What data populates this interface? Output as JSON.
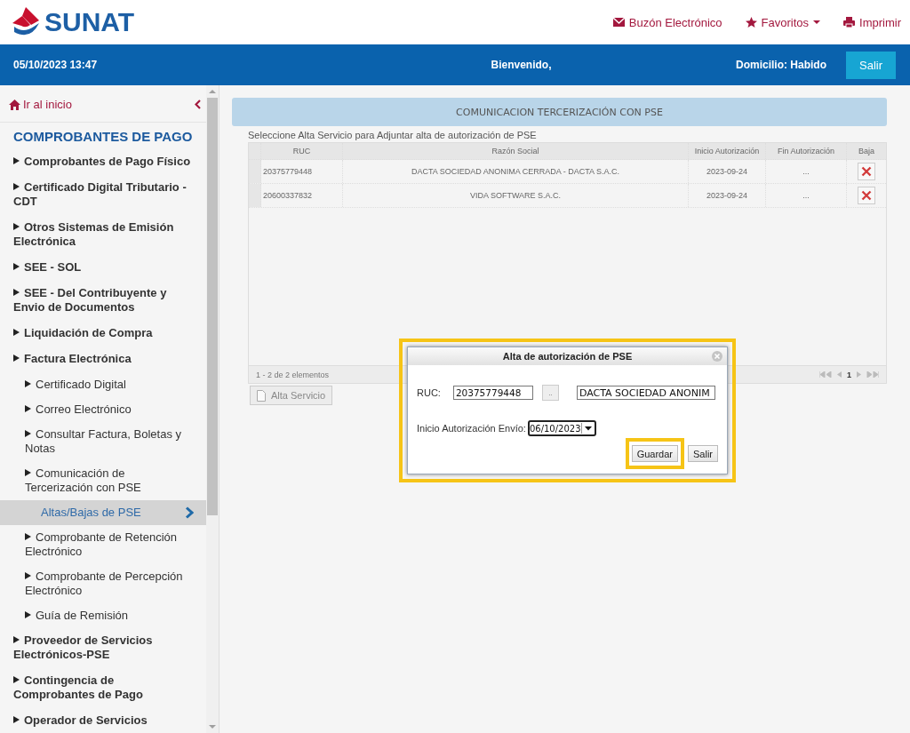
{
  "header": {
    "logo": "SUNAT",
    "links": [
      {
        "kind": "mail",
        "label": "Buzón Electrónico",
        "dropdown": false
      },
      {
        "kind": "star",
        "label": "Favoritos",
        "dropdown": true
      },
      {
        "kind": "print",
        "label": "Imprimir",
        "dropdown": false
      }
    ]
  },
  "top_bar": {
    "datetime": "05/10/2023 13:47",
    "welcome": "Bienvenido,",
    "domicilio": "Domicilio: Habido",
    "logout": "Salir"
  },
  "sidebar": {
    "home_link": "Ir al inicio",
    "section_title": "COMPROBANTES DE PAGO",
    "items": [
      {
        "kind": "folder",
        "label": "Comprobantes de Pago Físico",
        "selected": false
      },
      {
        "kind": "folder",
        "label": "Certificado Digital Tributario - CDT",
        "selected": false
      },
      {
        "kind": "folder",
        "label": "Otros Sistemas de Emisión Electrónica",
        "selected": false
      },
      {
        "kind": "folder",
        "label": "SEE - SOL",
        "selected": false
      },
      {
        "kind": "folder",
        "label": "SEE - Del Contribuyente y Envio de Documentos",
        "selected": false
      },
      {
        "kind": "folder",
        "label": "Liquidación de Compra",
        "selected": false
      },
      {
        "kind": "folder",
        "label": "Factura Electrónica",
        "selected": false,
        "children": [
          {
            "kind": "folder",
            "label": "Certificado Digital",
            "selected": false
          },
          {
            "kind": "folder",
            "label": "Correo Electrónico",
            "selected": false
          },
          {
            "kind": "folder",
            "label": "Consultar Factura, Boletas y Notas",
            "selected": false
          },
          {
            "kind": "folder",
            "label": "Comunicación de Tercerización con PSE",
            "selected": false,
            "children": [
              {
                "kind": "page",
                "label": "Altas/Bajas de PSE",
                "selected": true
              }
            ]
          },
          {
            "kind": "folder",
            "label": "Comprobante de Retención Electrónico",
            "selected": false
          },
          {
            "kind": "folder",
            "label": "Comprobante de Percepción Electrónico",
            "selected": false
          },
          {
            "kind": "folder",
            "label": "Guía de Remisión",
            "selected": false
          }
        ]
      },
      {
        "kind": "folder",
        "label": "Proveedor de Servicios Electrónicos-PSE",
        "selected": false
      },
      {
        "kind": "folder",
        "label": "Contingencia de Comprobantes de Pago",
        "selected": false
      },
      {
        "kind": "folder",
        "label": "Operador de Servicios",
        "selected": false
      }
    ]
  },
  "main": {
    "panel_title": "COMUNICACION TERCERIZACIÓN CON PSE",
    "instruction": "Seleccione Alta Servicio para Adjuntar alta de autorización de PSE",
    "table": {
      "columns": [
        "RUC",
        "Razón Social",
        "Inicio Autorización",
        "Fin Autorización",
        "Baja"
      ],
      "rows": [
        {
          "ruc": "20375779448",
          "razon_social": "DACTA SOCIEDAD ANONIMA CERRADA - DACTA S.A.C.",
          "inicio": "2023-09-24",
          "fin": "..."
        },
        {
          "ruc": "20600337832",
          "razon_social": "VIDA SOFTWARE S.A.C.",
          "inicio": "2023-09-24",
          "fin": "..."
        }
      ],
      "footer": "1 - 2 de 2 elementos",
      "page": "1"
    },
    "add_button": "Alta Servicio"
  },
  "dialog": {
    "title": "Alta de autorización de PSE",
    "highlighted": true,
    "ruc_label": "RUC:",
    "ruc_value": "20375779448",
    "lookup_button": "..",
    "name_value": "DACTA SOCIEDAD ANONIM",
    "date_label": "Inicio Autorización Envío:",
    "date_value": "06/10/2023",
    "buttons": [
      {
        "label": "Guardar",
        "highlighted": true
      },
      {
        "label": "Salir",
        "highlighted": false
      }
    ]
  }
}
